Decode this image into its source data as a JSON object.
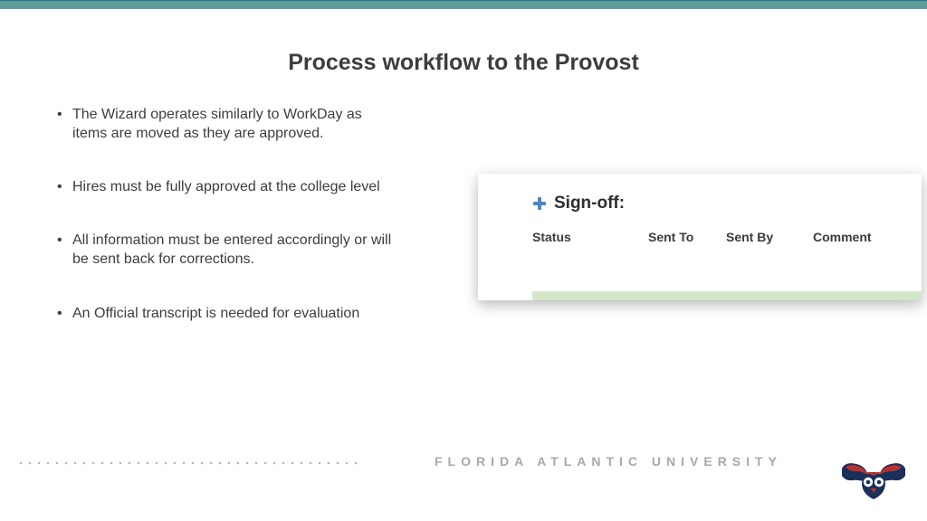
{
  "title": "Process workflow to the Provost",
  "bullets": [
    "The Wizard operates similarly to WorkDay as items are moved as they are approved.",
    "Hires must be fully approved at the college level",
    "All information must be entered accordingly or will be sent back for corrections.",
    "An Official transcript is needed for evaluation"
  ],
  "signoff": {
    "label": "Sign-off:",
    "columns": [
      "Status",
      "Sent To",
      "Sent By",
      "Comment"
    ]
  },
  "footer": "FLORIDA ATLANTIC UNIVERSITY"
}
